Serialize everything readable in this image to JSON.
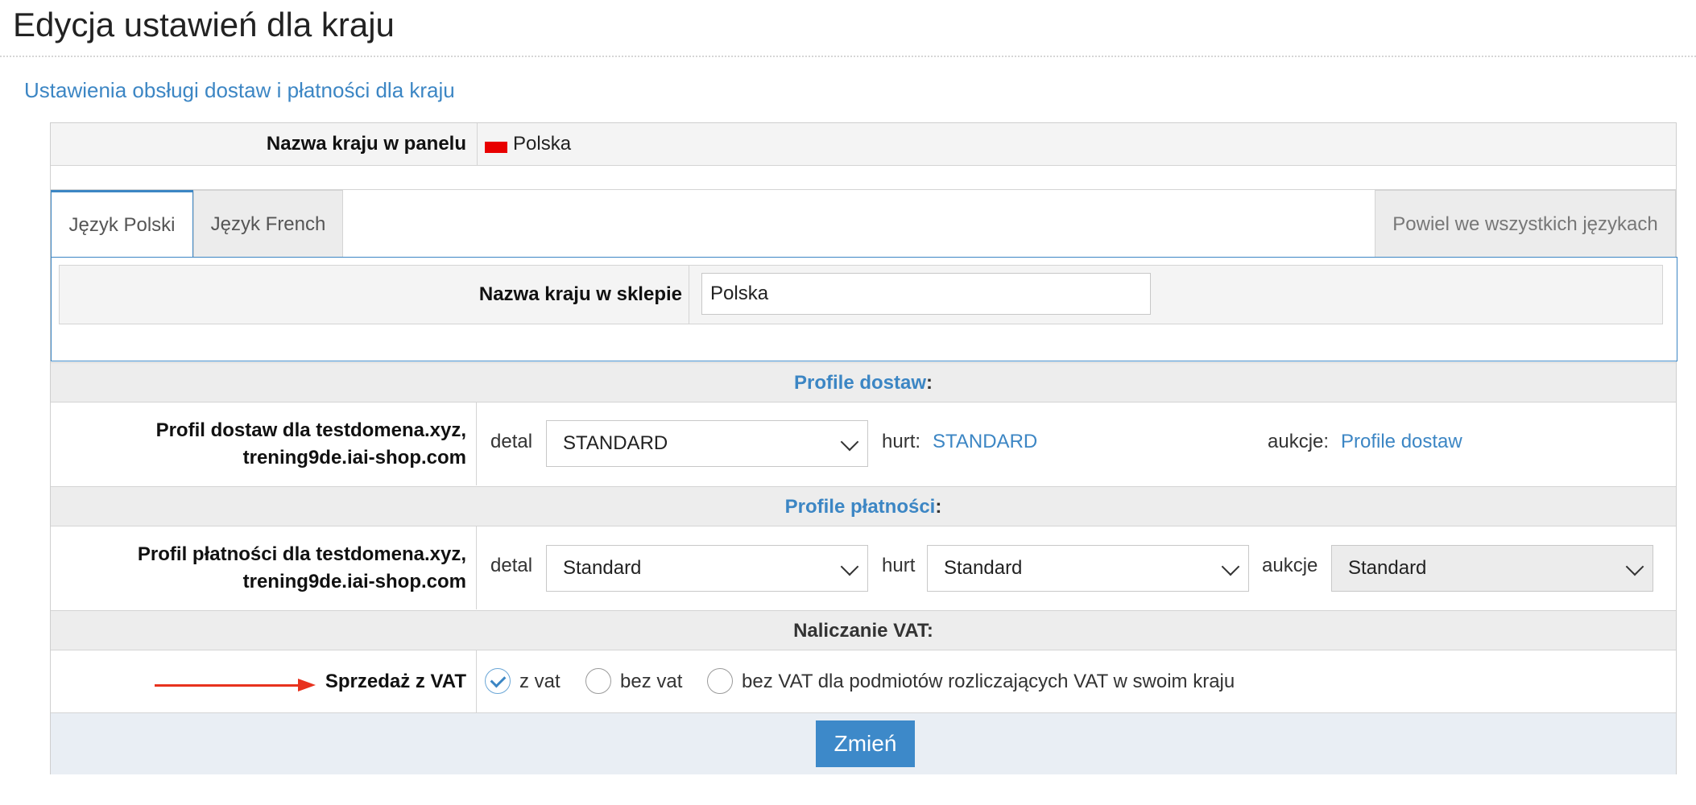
{
  "page": {
    "title": "Edycja ustawień dla kraju",
    "section_link": "Ustawienia obsługi dostaw i płatności dla kraju"
  },
  "country": {
    "panel_label": "Nazwa kraju w panelu",
    "panel_value": "Polska",
    "flag_color": "#e80000"
  },
  "tabs": [
    {
      "label": "Język Polski",
      "active": true
    },
    {
      "label": "Język French",
      "active": false
    }
  ],
  "copy_all_label": "Powiel we wszystkich językach",
  "shop_name": {
    "label": "Nazwa kraju w sklepie",
    "value": "Polska"
  },
  "delivery": {
    "header": "Profile dostaw",
    "row_label_1": "Profil dostaw dla testdomena.xyz,",
    "row_label_2": "trening9de.iai-shop.com",
    "retail_label": "detal",
    "retail_value": "STANDARD",
    "wholesale_label": "hurt:",
    "wholesale_value": "STANDARD",
    "auction_label": "aukcje:",
    "auction_value": "Profile dostaw"
  },
  "payment": {
    "header": "Profile płatności",
    "row_label_1": "Profil płatności dla testdomena.xyz,",
    "row_label_2": "trening9de.iai-shop.com",
    "retail_label": "detal",
    "retail_value": "Standard",
    "wholesale_label": "hurt",
    "wholesale_value": "Standard",
    "auction_label": "aukcje",
    "auction_value": "Standard"
  },
  "vat": {
    "header": "Naliczanie VAT:",
    "row_label": "Sprzedaż z VAT",
    "options": [
      {
        "label": "z vat",
        "checked": true
      },
      {
        "label": "bez vat",
        "checked": false
      },
      {
        "label": "bez VAT dla podmiotów rozliczających VAT w swoim kraju",
        "checked": false
      }
    ]
  },
  "actions": {
    "submit_label": "Zmień"
  },
  "colors": {
    "accent": "#3c86c4",
    "button": "#3d89c9",
    "annotation_arrow": "#e8321e"
  }
}
